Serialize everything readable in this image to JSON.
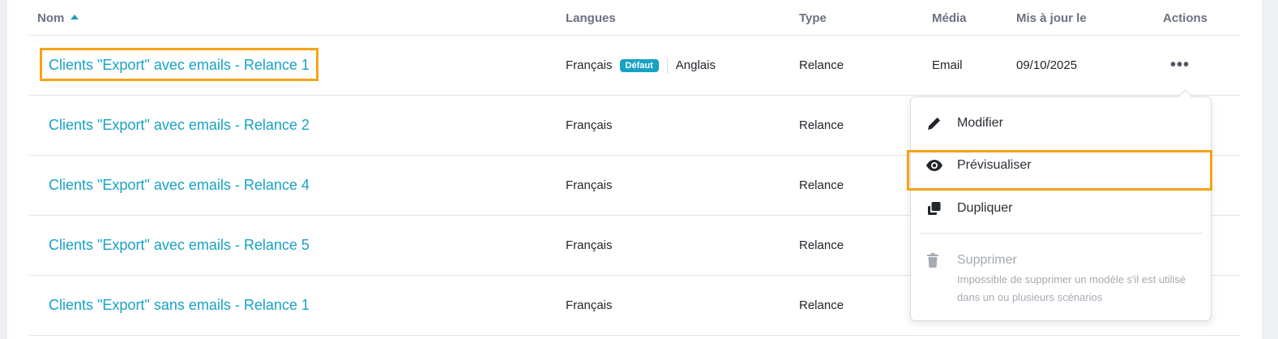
{
  "table": {
    "headers": {
      "name": "Nom",
      "languages": "Langues",
      "type": "Type",
      "media": "Média",
      "updated": "Mis à jour le",
      "actions": "Actions"
    },
    "rows": [
      {
        "name": "Clients \"Export\" avec emails - Relance 1",
        "lang": "Français",
        "lang_default": "Défaut",
        "lang2": "Anglais",
        "type": "Relance",
        "media": "Email",
        "updated": "09/10/2025",
        "actions": "•••"
      },
      {
        "name": "Clients \"Export\" avec emails - Relance 2",
        "lang": "Français",
        "type": "Relance"
      },
      {
        "name": "Clients \"Export\" avec emails - Relance 4",
        "lang": "Français",
        "type": "Relance"
      },
      {
        "name": "Clients \"Export\" avec emails - Relance 5",
        "lang": "Français",
        "type": "Relance"
      },
      {
        "name": "Clients \"Export\" sans emails - Relance 1",
        "lang": "Français",
        "type": "Relance"
      }
    ]
  },
  "menu": {
    "items": [
      {
        "label": "Modifier",
        "icon": "pencil-icon"
      },
      {
        "label": "Prévisualiser",
        "icon": "eye-icon"
      },
      {
        "label": "Dupliquer",
        "icon": "duplicate-icon"
      }
    ],
    "delete": {
      "label": "Supprimer",
      "icon": "trash-icon",
      "description": "Impossible de supprimer un modèle s'il est utilisé dans un ou plusieurs scénarios"
    }
  },
  "colors": {
    "accent": "#17a2c4",
    "highlight": "#f5a316"
  }
}
